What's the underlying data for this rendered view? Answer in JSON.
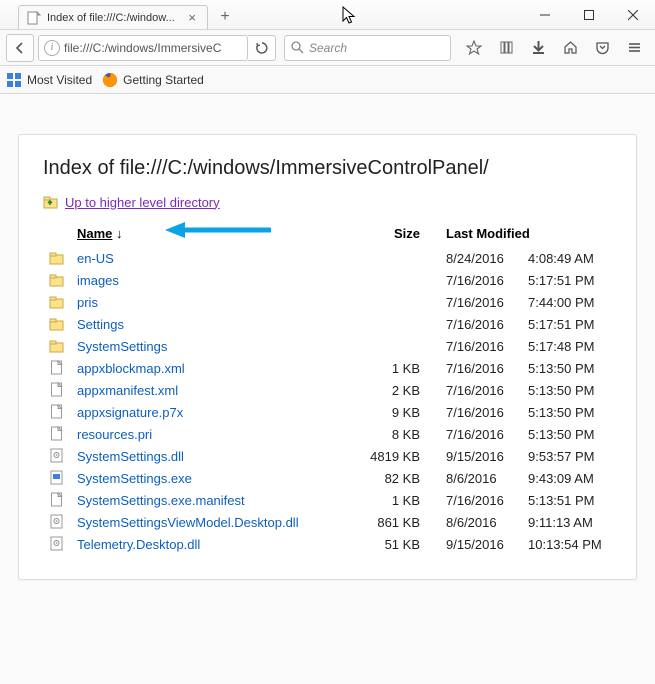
{
  "window": {
    "tab_title": "Index of file:///C:/window...",
    "minimize": "—",
    "maximize": "☐",
    "close": "✕"
  },
  "nav": {
    "url_display": "file:///C:/windows/ImmersiveC",
    "search_placeholder": "Search"
  },
  "bookmarks": {
    "most_visited": "Most Visited",
    "getting_started": "Getting Started"
  },
  "page": {
    "heading": "Index of file:///C:/windows/ImmersiveControlPanel/",
    "up_link": "Up to higher level directory",
    "columns": {
      "name": "Name",
      "size": "Size",
      "modified": "Last Modified"
    },
    "sort_indicator": "↓",
    "entries": [
      {
        "type": "folder",
        "name": "en-US",
        "size": "",
        "date": "8/24/2016",
        "time": "4:08:49 AM"
      },
      {
        "type": "folder",
        "name": "images",
        "size": "",
        "date": "7/16/2016",
        "time": "5:17:51 PM"
      },
      {
        "type": "folder",
        "name": "pris",
        "size": "",
        "date": "7/16/2016",
        "time": "7:44:00 PM"
      },
      {
        "type": "folder",
        "name": "Settings",
        "size": "",
        "date": "7/16/2016",
        "time": "5:17:51 PM"
      },
      {
        "type": "folder",
        "name": "SystemSettings",
        "size": "",
        "date": "7/16/2016",
        "time": "5:17:48 PM"
      },
      {
        "type": "file",
        "name": "appxblockmap.xml",
        "size": "1 KB",
        "date": "7/16/2016",
        "time": "5:13:50 PM"
      },
      {
        "type": "file",
        "name": "appxmanifest.xml",
        "size": "2 KB",
        "date": "7/16/2016",
        "time": "5:13:50 PM"
      },
      {
        "type": "file",
        "name": "appxsignature.p7x",
        "size": "9 KB",
        "date": "7/16/2016",
        "time": "5:13:50 PM"
      },
      {
        "type": "file",
        "name": "resources.pri",
        "size": "8 KB",
        "date": "7/16/2016",
        "time": "5:13:50 PM"
      },
      {
        "type": "dll",
        "name": "SystemSettings.dll",
        "size": "4819 KB",
        "date": "9/15/2016",
        "time": "9:53:57 PM"
      },
      {
        "type": "exe",
        "name": "SystemSettings.exe",
        "size": "82 KB",
        "date": "8/6/2016",
        "time": "9:43:09 AM"
      },
      {
        "type": "file",
        "name": "SystemSettings.exe.manifest",
        "size": "1 KB",
        "date": "7/16/2016",
        "time": "5:13:51 PM"
      },
      {
        "type": "dll",
        "name": "SystemSettingsViewModel.Desktop.dll",
        "size": "861 KB",
        "date": "8/6/2016",
        "time": "9:11:13 AM"
      },
      {
        "type": "dll",
        "name": "Telemetry.Desktop.dll",
        "size": "51 KB",
        "date": "9/15/2016",
        "time": "10:13:54 PM"
      }
    ]
  }
}
